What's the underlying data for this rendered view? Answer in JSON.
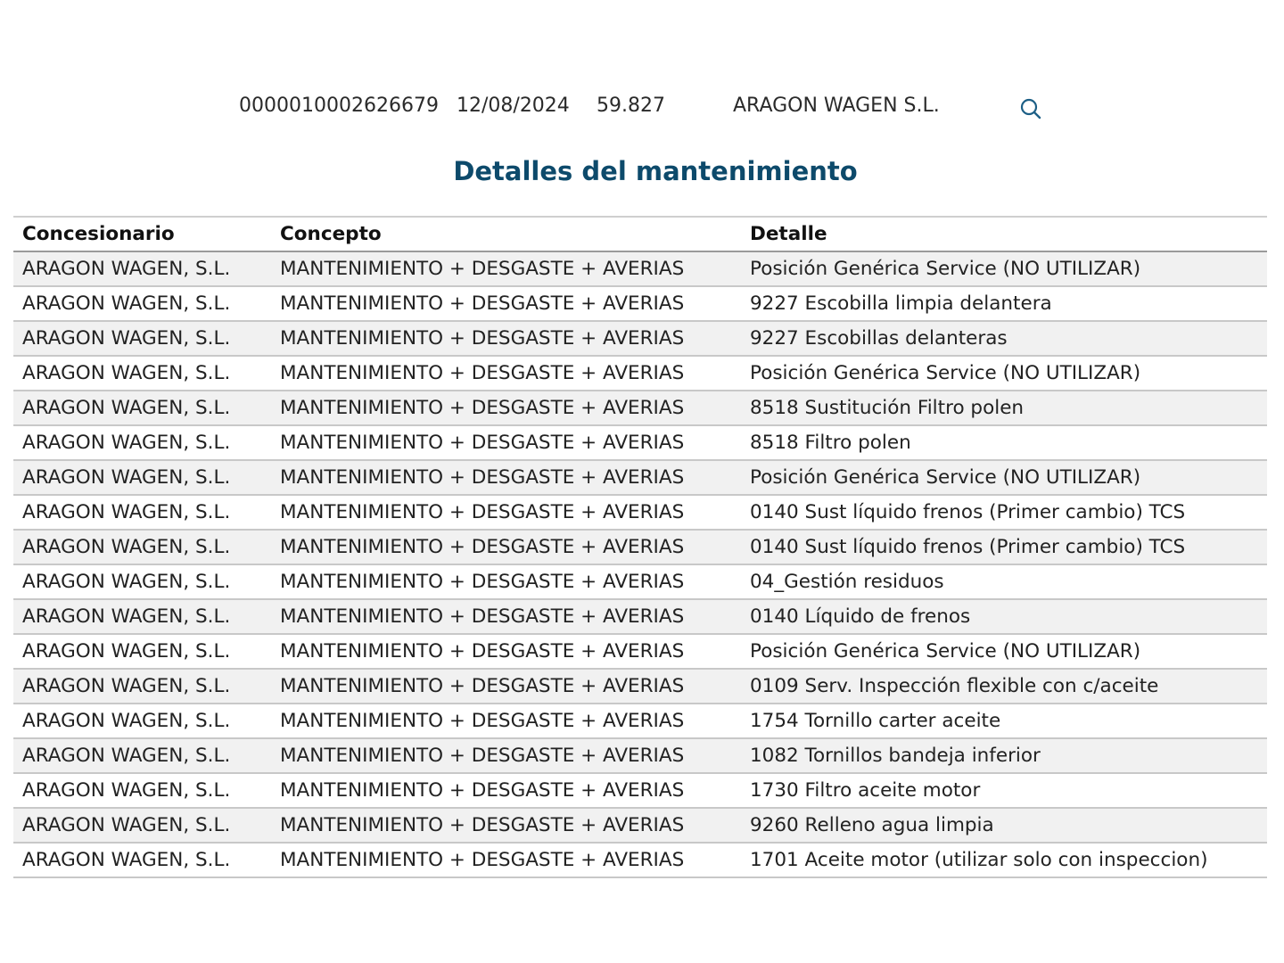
{
  "summary": {
    "id": "0000010002626679",
    "date": "12/08/2024",
    "km": "59.827",
    "dealer": "ARAGON WAGEN S.L.",
    "search_icon": "search-icon"
  },
  "title": "Detalles del mantenimiento",
  "table": {
    "headers": [
      "Concesionario",
      "Concepto",
      "Detalle"
    ],
    "rows": [
      [
        "ARAGON WAGEN, S.L.",
        "MANTENIMIENTO + DESGASTE + AVERIAS",
        "Posición Genérica Service (NO UTILIZAR)"
      ],
      [
        "ARAGON WAGEN, S.L.",
        "MANTENIMIENTO + DESGASTE + AVERIAS",
        "9227 Escobilla limpia delantera"
      ],
      [
        "ARAGON WAGEN, S.L.",
        "MANTENIMIENTO + DESGASTE + AVERIAS",
        "9227 Escobillas delanteras"
      ],
      [
        "ARAGON WAGEN, S.L.",
        "MANTENIMIENTO + DESGASTE + AVERIAS",
        "Posición Genérica Service (NO UTILIZAR)"
      ],
      [
        "ARAGON WAGEN, S.L.",
        "MANTENIMIENTO + DESGASTE + AVERIAS",
        "8518 Sustitución Filtro polen"
      ],
      [
        "ARAGON WAGEN, S.L.",
        "MANTENIMIENTO + DESGASTE + AVERIAS",
        "8518 Filtro polen"
      ],
      [
        "ARAGON WAGEN, S.L.",
        "MANTENIMIENTO + DESGASTE + AVERIAS",
        "Posición Genérica Service (NO UTILIZAR)"
      ],
      [
        "ARAGON WAGEN, S.L.",
        "MANTENIMIENTO + DESGASTE + AVERIAS",
        "0140 Sust líquido frenos (Primer cambio) TCS"
      ],
      [
        "ARAGON WAGEN, S.L.",
        "MANTENIMIENTO + DESGASTE + AVERIAS",
        "0140 Sust líquido frenos (Primer cambio) TCS"
      ],
      [
        "ARAGON WAGEN, S.L.",
        "MANTENIMIENTO + DESGASTE + AVERIAS",
        "04_Gestión residuos"
      ],
      [
        "ARAGON WAGEN, S.L.",
        "MANTENIMIENTO + DESGASTE + AVERIAS",
        "0140 Líquido de frenos"
      ],
      [
        "ARAGON WAGEN, S.L.",
        "MANTENIMIENTO + DESGASTE + AVERIAS",
        "Posición Genérica Service (NO UTILIZAR)"
      ],
      [
        "ARAGON WAGEN, S.L.",
        "MANTENIMIENTO + DESGASTE + AVERIAS",
        "0109 Serv. Inspección flexible con c/aceite"
      ],
      [
        "ARAGON WAGEN, S.L.",
        "MANTENIMIENTO + DESGASTE + AVERIAS",
        "1754 Tornillo carter aceite"
      ],
      [
        "ARAGON WAGEN, S.L.",
        "MANTENIMIENTO + DESGASTE + AVERIAS",
        "1082 Tornillos bandeja inferior"
      ],
      [
        "ARAGON WAGEN, S.L.",
        "MANTENIMIENTO + DESGASTE + AVERIAS",
        "1730 Filtro aceite motor"
      ],
      [
        "ARAGON WAGEN, S.L.",
        "MANTENIMIENTO + DESGASTE + AVERIAS",
        "9260 Relleno agua limpia"
      ],
      [
        "ARAGON WAGEN, S.L.",
        "MANTENIMIENTO + DESGASTE + AVERIAS",
        "1701 Aceite motor (utilizar solo con inspeccion)"
      ]
    ]
  }
}
